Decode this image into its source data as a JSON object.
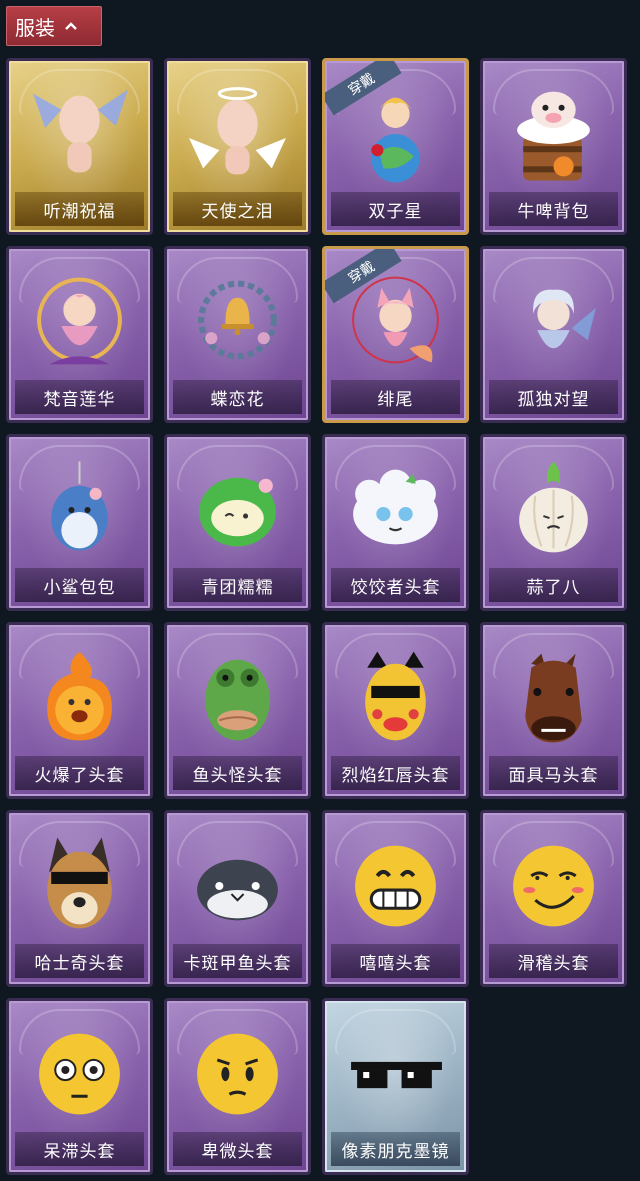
{
  "header": {
    "title": "服装",
    "icon": "chevron-up-icon"
  },
  "worn_badge": "穿戴",
  "items": [
    {
      "name": "听潮祝福",
      "style": "gold",
      "worn": false,
      "icon": "doll-wings-icon"
    },
    {
      "name": "天使之泪",
      "style": "gold",
      "worn": false,
      "icon": "doll-halo-icon"
    },
    {
      "name": "双子星",
      "style": "purple",
      "worn": true,
      "icon": "boy-on-globe-icon"
    },
    {
      "name": "牛啤背包",
      "style": "purple",
      "worn": false,
      "icon": "cow-beer-barrel-icon"
    },
    {
      "name": "梵音莲华",
      "style": "purple",
      "worn": false,
      "icon": "lotus-doll-icon"
    },
    {
      "name": "蝶恋花",
      "style": "purple",
      "worn": false,
      "icon": "bell-wreath-icon"
    },
    {
      "name": "绯尾",
      "style": "purple",
      "worn": true,
      "icon": "fox-girl-icon"
    },
    {
      "name": "孤独对望",
      "style": "purple",
      "worn": false,
      "icon": "white-hair-doll-icon"
    },
    {
      "name": "小鲨包包",
      "style": "purple",
      "worn": false,
      "icon": "shark-bag-icon"
    },
    {
      "name": "青团糯糯",
      "style": "purple",
      "worn": false,
      "icon": "green-dumpling-icon"
    },
    {
      "name": "饺饺者头套",
      "style": "purple",
      "worn": false,
      "icon": "dumpling-head-icon"
    },
    {
      "name": "蒜了八",
      "style": "purple",
      "worn": false,
      "icon": "garlic-icon"
    },
    {
      "name": "火爆了头套",
      "style": "purple",
      "worn": false,
      "icon": "fire-head-icon"
    },
    {
      "name": "鱼头怪头套",
      "style": "purple",
      "worn": false,
      "icon": "fish-head-icon"
    },
    {
      "name": "烈焰红唇头套",
      "style": "purple",
      "worn": false,
      "icon": "yellow-mask-icon"
    },
    {
      "name": "面具马头套",
      "style": "purple",
      "worn": false,
      "icon": "horse-head-icon"
    },
    {
      "name": "哈士奇头套",
      "style": "purple",
      "worn": false,
      "icon": "husky-head-icon"
    },
    {
      "name": "卡斑甲鱼头套",
      "style": "purple",
      "worn": false,
      "icon": "whale-head-icon"
    },
    {
      "name": "嘻嘻头套",
      "style": "purple",
      "worn": false,
      "icon": "grin-emoji-icon"
    },
    {
      "name": "滑稽头套",
      "style": "purple",
      "worn": false,
      "icon": "funny-emoji-icon"
    },
    {
      "name": "呆滞头套",
      "style": "purple",
      "worn": false,
      "icon": "stare-emoji-icon"
    },
    {
      "name": "卑微头套",
      "style": "purple",
      "worn": false,
      "icon": "humble-emoji-icon"
    },
    {
      "name": "像素朋克墨镜",
      "style": "blue",
      "worn": false,
      "icon": "pixel-sunglasses-icon"
    }
  ]
}
